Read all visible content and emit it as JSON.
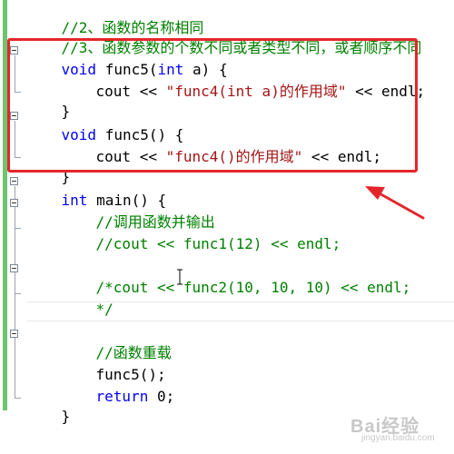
{
  "editor": {
    "lines": {
      "l1": "//2、函数的名称相同",
      "l2": "//3、函数参数的个数不同或者类型不同，或者顺序不同",
      "l3_kw": "void",
      "l3_rest": " func5(",
      "l3_kw2": "int",
      "l3_rest2": " a) {",
      "l4_a": "cout << ",
      "l4_str": "\"func4(int a)的作用域\"",
      "l4_b": " << endl;",
      "l5": "}",
      "l6_kw": "void",
      "l6_rest": " func5() {",
      "l7_a": "cout << ",
      "l7_str": "\"func4()的作用域\"",
      "l7_b": " << endl;",
      "l8": "}",
      "l9_kw": "int",
      "l9_rest": " main() {",
      "l10": "//调用函数并输出",
      "l11": "//cout << func1(12) << endl;",
      "l13": "/*cout << func2(10, 10, 10) << endl;",
      "l14": "*/",
      "l16": "//函数重载",
      "l17": "func5();",
      "l18_kw": "return",
      "l18_rest": " 0;",
      "l19": "}"
    },
    "colors": {
      "keyword": "#0000ff",
      "string": "#a31515",
      "comment": "#008000",
      "highlight_border": "#e4262b",
      "change_bar": "#6ec46e"
    }
  },
  "annotation": {
    "highlight": "red-rectangle",
    "arrow": "red-arrow"
  },
  "watermark": {
    "brand": "Bai经验",
    "sub": "jingyan.baidu.com"
  }
}
